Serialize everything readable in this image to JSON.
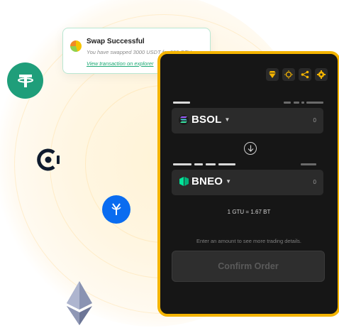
{
  "toast": {
    "title": "Swap Successful",
    "message": "You have swapped 3000 USDT for 200 GTU",
    "link": "View transaction on explorer"
  },
  "toolbar": {
    "icons": [
      "gem-icon",
      "sun-icon",
      "share-icon",
      "settings-icon"
    ]
  },
  "from": {
    "token": "BSOL",
    "amount": "0"
  },
  "to": {
    "token": "BNEO",
    "amount": "0"
  },
  "rate": "1 GTU = 1.67 BT",
  "hint": "Enter an amount to see more trading details.",
  "confirm_label": "Confirm Order",
  "colors": {
    "accent": "#f4b400",
    "panel_bg": "#161616",
    "success": "#1aa873"
  },
  "floating_coins": [
    "tether-icon",
    "ocean-protocol-icon",
    "yearn-icon",
    "ethereum-icon"
  ]
}
